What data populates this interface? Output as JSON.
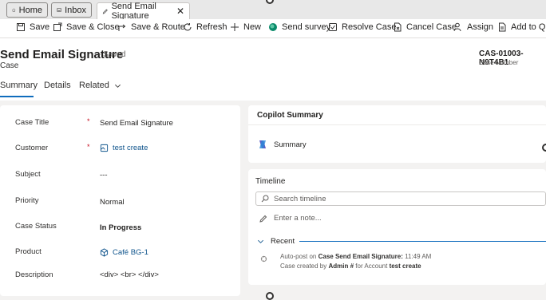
{
  "tabs": [
    {
      "label": "Home",
      "icon": "home-icon"
    },
    {
      "label": "Inbox",
      "icon": "inbox-icon"
    },
    {
      "label": "Send Email Signature",
      "icon": "pencil-icon"
    }
  ],
  "toolbar": {
    "save": "Save",
    "save_close": "Save & Close",
    "save_route": "Save & Route",
    "refresh": "Refresh",
    "new": "New",
    "send_survey": "Send survey",
    "resolve": "Resolve Case",
    "cancel": "Cancel Case",
    "assign": "Assign",
    "add_queue": "Add to Que"
  },
  "header": {
    "title": "Send Email Signature",
    "saved": "- Saved",
    "entity": "Case",
    "case_number": "CAS-01003-N9T4B1",
    "case_number_label": "Case Number"
  },
  "nav": {
    "summary": "Summary",
    "details": "Details",
    "related": "Related"
  },
  "fields": {
    "case_title_label": "Case Title",
    "case_title": "Send Email Signature",
    "customer_label": "Customer",
    "customer": "test create",
    "subject_label": "Subject",
    "subject": "---",
    "priority_label": "Priority",
    "priority": "Normal",
    "status_label": "Case Status",
    "status": "In Progress",
    "product_label": "Product",
    "product": "Café BG-1",
    "description_label": "Description",
    "description": "<div> <br> </div>",
    "required_mark": "*"
  },
  "copilot": {
    "title": "Copilot Summary",
    "summary": "Summary"
  },
  "timeline": {
    "title": "Timeline",
    "search_placeholder": "Search timeline",
    "note_placeholder": "Enter a note...",
    "recent": "Recent",
    "post_prefix": "Auto-post on",
    "post_case": "Case Send Email Signature:",
    "post_time": "11:49 AM",
    "post_line2_a": "Case created by",
    "post_line2_user": "Admin #",
    "post_line2_b": "for Account",
    "post_line2_account": "test create"
  }
}
